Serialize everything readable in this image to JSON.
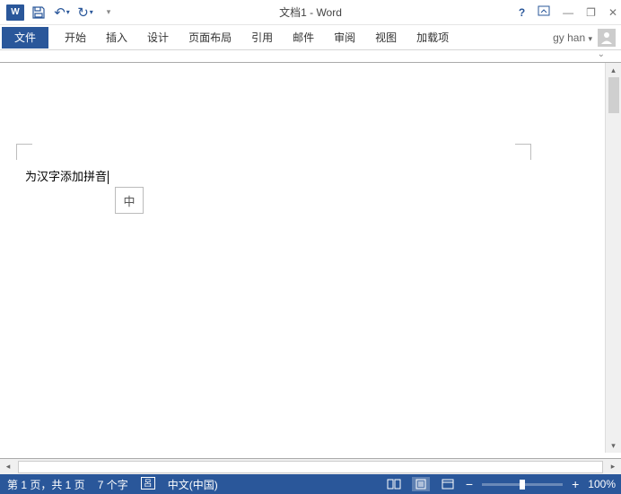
{
  "title": "文档1 - Word",
  "qat": {
    "undo": "↶",
    "redo": "↻"
  },
  "winctl": {
    "help": "?",
    "ribbon_opts": "▭",
    "min": "—",
    "restore": "❐",
    "close": "✕"
  },
  "ribbon": {
    "file": "文件",
    "tabs": [
      "开始",
      "插入",
      "设计",
      "页面布局",
      "引用",
      "邮件",
      "审阅",
      "视图",
      "加载项"
    ]
  },
  "user": "gy han",
  "document": {
    "text": "为汉字添加拼音",
    "ime_indicator": "中"
  },
  "status": {
    "page": "第 1 页，共 1 页",
    "words": "7 个字",
    "lang_icon": "呂",
    "lang": "中文(中国)",
    "zoom_minus": "−",
    "zoom_plus": "+",
    "zoom": "100%"
  }
}
